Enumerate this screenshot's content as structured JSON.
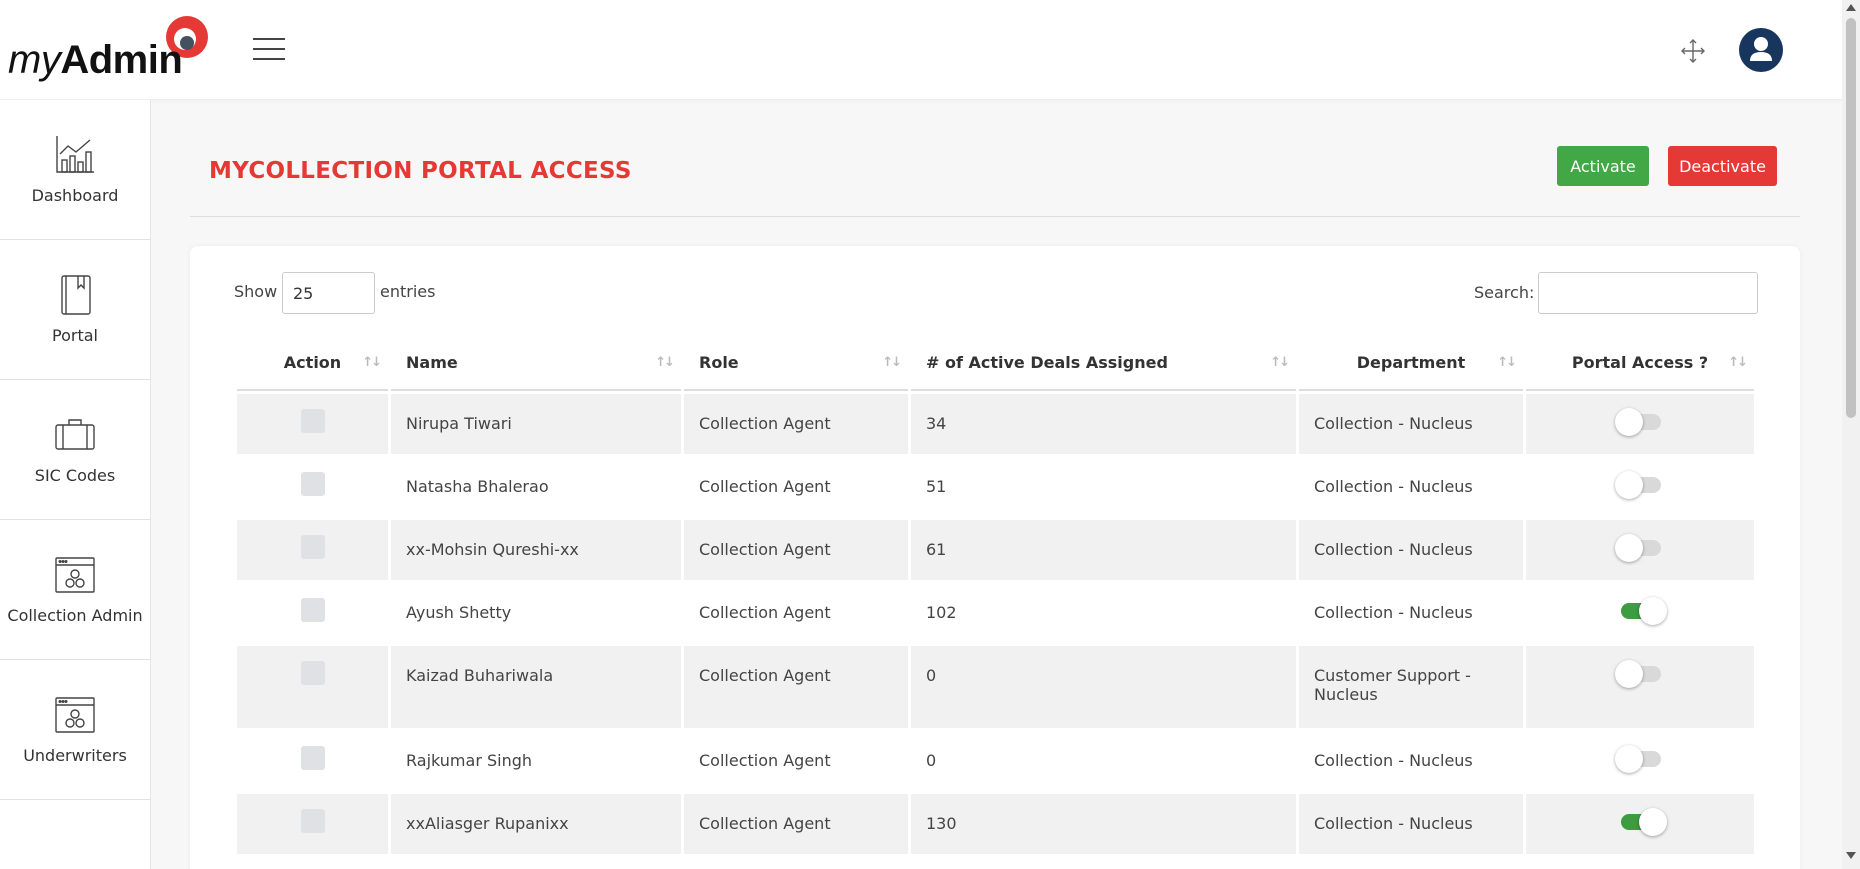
{
  "app": {
    "logo_my": "my",
    "logo_admin": "Admin"
  },
  "header": {
    "menu_icon": "hamburger-icon",
    "expand_icon": "expand-arrows-icon",
    "avatar_icon": "user-avatar-icon"
  },
  "sidebar": {
    "items": [
      {
        "label": "Dashboard",
        "icon": "chart-icon"
      },
      {
        "label": "Portal",
        "icon": "book-icon"
      },
      {
        "label": "SIC Codes",
        "icon": "briefcase-icon"
      },
      {
        "label": "Collection Admin",
        "icon": "settings-window-icon"
      },
      {
        "label": "Underwriters",
        "icon": "settings-window-icon"
      }
    ]
  },
  "page": {
    "title": "MYCOLLECTION PORTAL ACCESS",
    "activate_label": "Activate",
    "deactivate_label": "Deactivate"
  },
  "table_controls": {
    "show_label": "Show",
    "entries_value": "25",
    "entries_label": "entries",
    "search_label": "Search:",
    "search_value": ""
  },
  "table": {
    "columns": [
      "Action",
      "Name",
      "Role",
      "# of Active Deals Assigned",
      "Department",
      "Portal Access ?"
    ],
    "rows": [
      {
        "name": "Nirupa Tiwari",
        "role": "Collection Agent",
        "deals": "34",
        "department": "Collection - Nucleus",
        "access": false
      },
      {
        "name": "Natasha Bhalerao",
        "role": "Collection Agent",
        "deals": "51",
        "department": "Collection - Nucleus",
        "access": false
      },
      {
        "name": "xx-Mohsin Qureshi-xx",
        "role": "Collection Agent",
        "deals": "61",
        "department": "Collection - Nucleus",
        "access": false
      },
      {
        "name": "Ayush Shetty",
        "role": "Collection Agent",
        "deals": "102",
        "department": "Collection - Nucleus",
        "access": true
      },
      {
        "name": "Kaizad Buhariwala",
        "role": "Collection Agent",
        "deals": "0",
        "department": "Customer Support - Nucleus",
        "access": false
      },
      {
        "name": "Rajkumar Singh",
        "role": "Collection Agent",
        "deals": "0",
        "department": "Collection - Nucleus",
        "access": false
      },
      {
        "name": "xxAliasger Rupanixx",
        "role": "Collection Agent",
        "deals": "130",
        "department": "Collection - Nucleus",
        "access": true
      }
    ]
  },
  "colors": {
    "accent": "#e53935",
    "success": "#41a845",
    "avatar": "#17355d"
  }
}
